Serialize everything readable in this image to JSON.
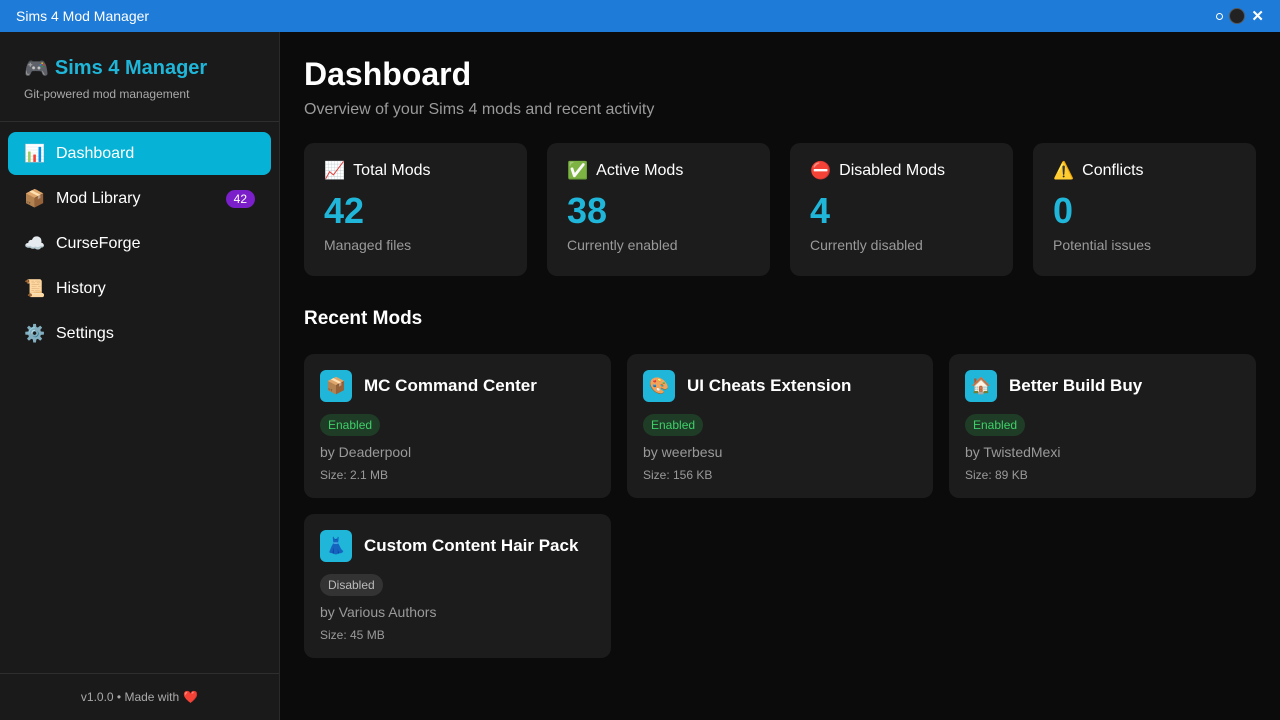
{
  "window": {
    "title": "Sims 4 Mod Manager"
  },
  "sidebar": {
    "brand_icon": "🎮",
    "brand_title": "Sims 4 Manager",
    "brand_subtitle": "Git-powered mod management",
    "items": [
      {
        "icon": "📊",
        "label": "Dashboard",
        "active": true
      },
      {
        "icon": "📦",
        "label": "Mod Library",
        "badge": "42"
      },
      {
        "icon": "☁️",
        "label": "CurseForge"
      },
      {
        "icon": "📜",
        "label": "History"
      },
      {
        "icon": "⚙️",
        "label": "Settings"
      }
    ],
    "footer_text": "v1.0.0 • Made with",
    "footer_heart": "❤️"
  },
  "main": {
    "title": "Dashboard",
    "subtitle": "Overview of your Sims 4 mods and recent activity",
    "stats": [
      {
        "icon": "📈",
        "label": "Total Mods",
        "value": "42",
        "desc": "Managed files"
      },
      {
        "icon": "✅",
        "label": "Active Mods",
        "value": "38",
        "desc": "Currently enabled"
      },
      {
        "icon": "⛔",
        "label": "Disabled Mods",
        "value": "4",
        "desc": "Currently disabled"
      },
      {
        "icon": "⚠️",
        "label": "Conflicts",
        "value": "0",
        "desc": "Potential issues"
      }
    ],
    "recent_title": "Recent Mods",
    "mods": [
      {
        "icon": "📦",
        "name": "MC Command Center",
        "status": "Enabled",
        "author": "by Deaderpool",
        "size": "Size: 2.1 MB"
      },
      {
        "icon": "🎨",
        "name": "UI Cheats Extension",
        "status": "Enabled",
        "author": "by weerbesu",
        "size": "Size: 156 KB"
      },
      {
        "icon": "🏠",
        "name": "Better Build Buy",
        "status": "Enabled",
        "author": "by TwistedMexi",
        "size": "Size: 89 KB"
      },
      {
        "icon": "👗",
        "name": "Custom Content Hair Pack",
        "status": "Disabled",
        "author": "by Various Authors",
        "size": "Size: 45 MB"
      }
    ]
  },
  "colors": {
    "accent": "#1fb6d9",
    "titlebar": "#1e7bd8",
    "badge": "#7a1fc9",
    "enabled": "#3fcf6a"
  }
}
